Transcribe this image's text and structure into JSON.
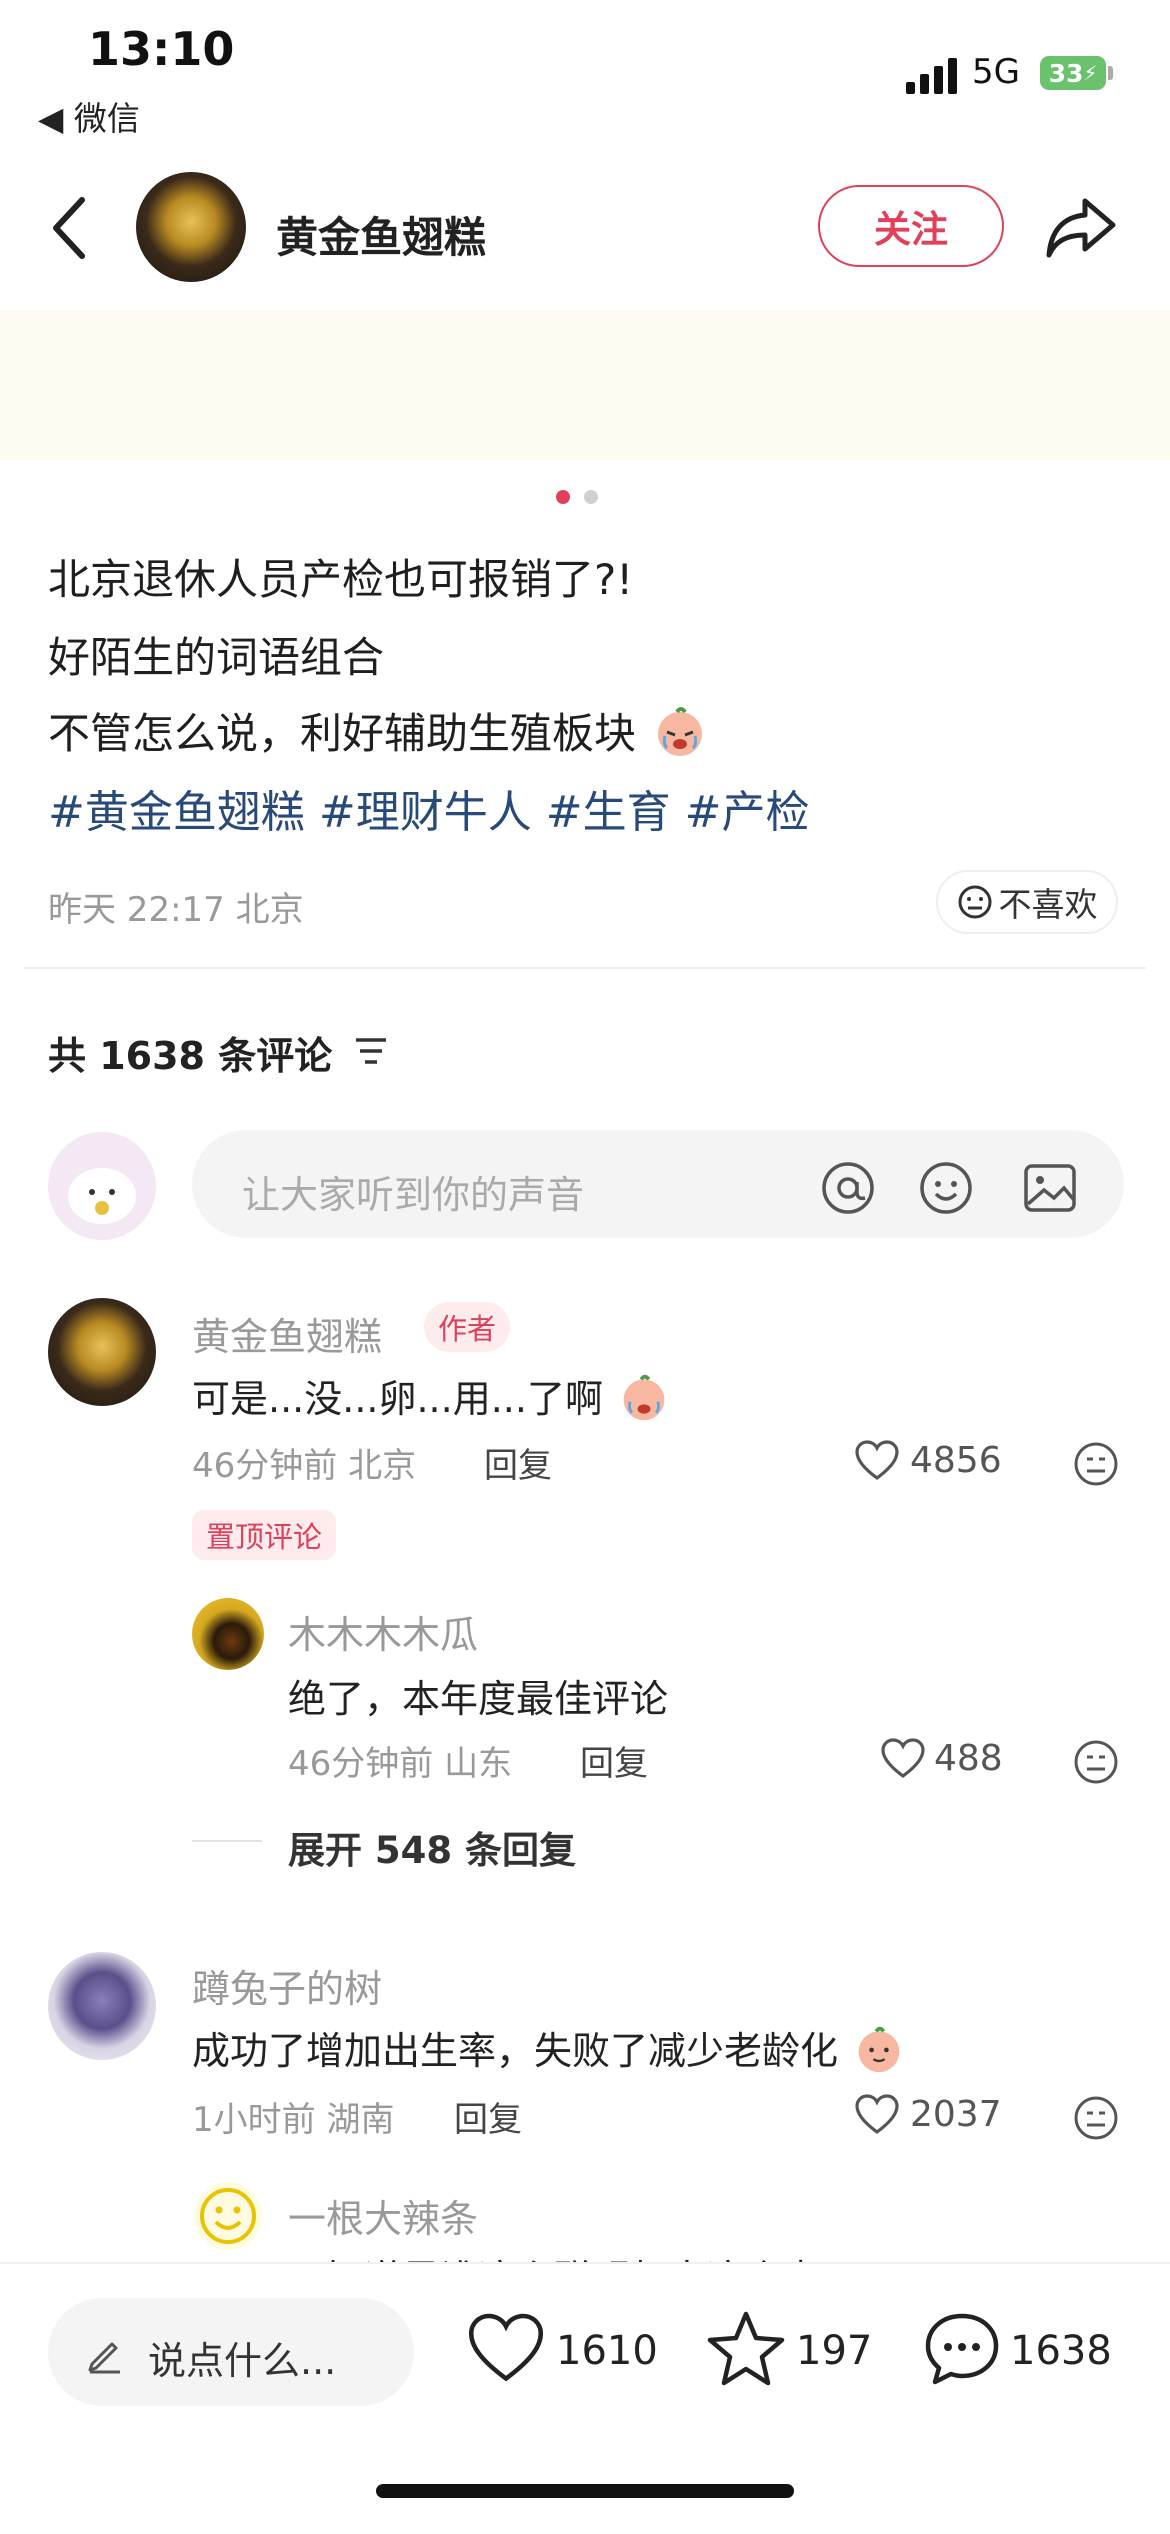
{
  "status_bar": {
    "time": "13:10",
    "back_app": "◀ 微信",
    "network": "5G",
    "battery": "33"
  },
  "header": {
    "author_name": "黄金鱼翅糕",
    "follow_label": "关注"
  },
  "post": {
    "lines": [
      "北京退休人员产检也可报销了?!",
      "好陌生的词语组合",
      "不管怎么说，利好辅助生殖板块"
    ],
    "hashtags": [
      "#黄金鱼翅糕",
      "#理财牛人",
      "#生育",
      "#产检"
    ],
    "time_location": "昨天 22:17 北京",
    "dislike_label": "不喜欢"
  },
  "comments_section": {
    "count_label": "共 1638 条评论",
    "input_placeholder": "让大家听到你的声音",
    "comments": [
      {
        "name": "黄金鱼翅糕",
        "tag": "作者",
        "text": "可是...没...卵...用...了啊",
        "meta": "46分钟前 北京",
        "reply": "回复",
        "likes": "4856",
        "pinned": "置顶评论"
      },
      {
        "name": "木木木木瓜",
        "text": "绝了，本年度最佳评论",
        "meta": "46分钟前 山东",
        "reply": "回复",
        "likes": "488"
      },
      {
        "expand": "展开 548 条回复"
      },
      {
        "name": "蹲兔子的树",
        "text": "成功了增加出生率，失败了减少老龄化",
        "meta": "1小时前 湖南",
        "reply": "回复",
        "likes": "2037"
      },
      {
        "name": "一根大辣条",
        "text": "不知道是谁这么聪明想出这个点子"
      }
    ]
  },
  "bottom_bar": {
    "say_placeholder": "说点什么...",
    "likes": "1610",
    "stars": "197",
    "comments": "1638"
  },
  "colors": {
    "accent": "#e0405a",
    "hashtag": "#274a7a"
  }
}
